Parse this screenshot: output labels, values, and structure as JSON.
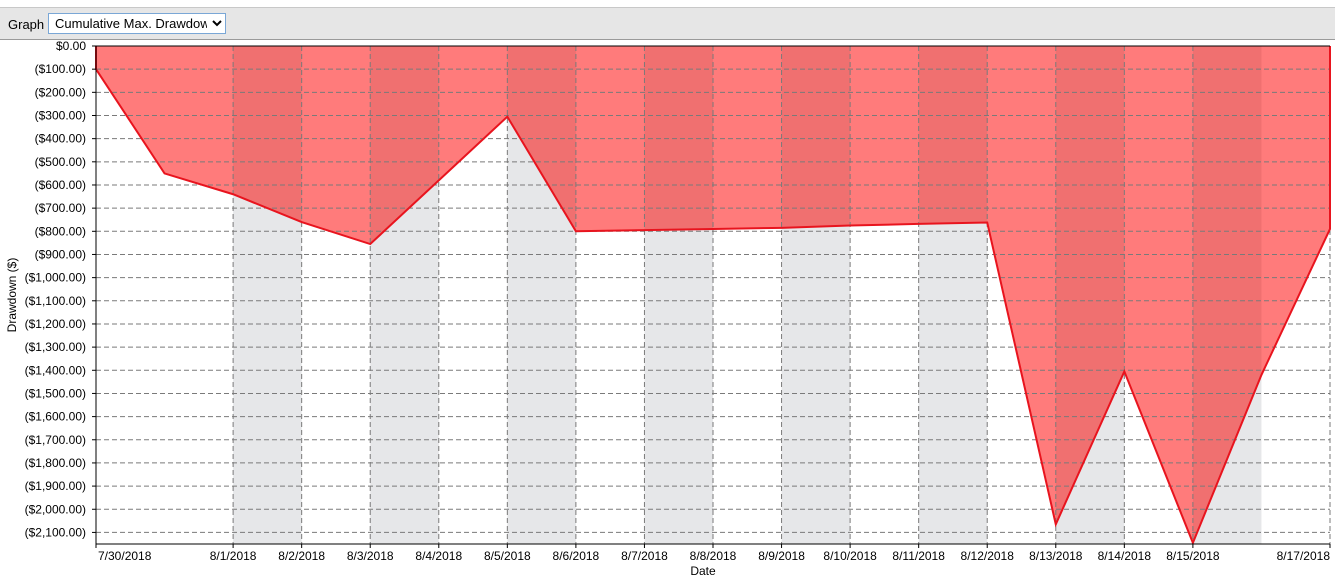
{
  "toolbar": {
    "graph_label": "Graph",
    "graph_select": {
      "selected": "Cumulative Max. Drawdown",
      "options": [
        "Cumulative Max. Drawdown"
      ]
    }
  },
  "chart_data": {
    "type": "area",
    "xlabel": "Date",
    "ylabel": "Drawdown ($)",
    "ylim": [
      -2150,
      0
    ],
    "yticks": [
      0,
      -100,
      -200,
      -300,
      -400,
      -500,
      -600,
      -700,
      -800,
      -900,
      -1000,
      -1100,
      -1200,
      -1300,
      -1400,
      -1500,
      -1600,
      -1700,
      -1800,
      -1900,
      -2000,
      -2100
    ],
    "ytick_labels": [
      "$0.00",
      "($100.00)",
      "($200.00)",
      "($300.00)",
      "($400.00)",
      "($500.00)",
      "($600.00)",
      "($700.00)",
      "($800.00)",
      "($900.00)",
      "($1,000.00)",
      "($1,100.00)",
      "($1,200.00)",
      "($1,300.00)",
      "($1,400.00)",
      "($1,500.00)",
      "($1,600.00)",
      "($1,700.00)",
      "($1,800.00)",
      "($1,900.00)",
      "($2,000.00)",
      "($2,100.00)"
    ],
    "xlim": [
      "2018-07-30",
      "2018-08-17"
    ],
    "xticks": [
      "2018-07-30",
      "2018-08-01",
      "2018-08-02",
      "2018-08-03",
      "2018-08-04",
      "2018-08-05",
      "2018-08-06",
      "2018-08-07",
      "2018-08-08",
      "2018-08-09",
      "2018-08-10",
      "2018-08-11",
      "2018-08-12",
      "2018-08-13",
      "2018-08-14",
      "2018-08-15",
      "2018-08-17"
    ],
    "xtick_labels": [
      "7/30/2018",
      "8/1/2018",
      "8/2/2018",
      "8/3/2018",
      "8/4/2018",
      "8/5/2018",
      "8/6/2018",
      "8/7/2018",
      "8/8/2018",
      "8/9/2018",
      "8/10/2018",
      "8/11/2018",
      "8/12/2018",
      "8/13/2018",
      "8/14/2018",
      "8/15/2018",
      "8/17/2018"
    ],
    "grid": true,
    "colors": {
      "fill_light": "#ff7b7b",
      "fill_dark": "#f07070",
      "line": "#e8141e",
      "band": "#e6e7e9",
      "grid": "#7a7a7a"
    },
    "series": [
      {
        "points": [
          {
            "x": "2018-07-30",
            "y": -100
          },
          {
            "x": "2018-07-31",
            "y": -550
          },
          {
            "x": "2018-08-01",
            "y": -640
          },
          {
            "x": "2018-08-02",
            "y": -760
          },
          {
            "x": "2018-08-03",
            "y": -855
          },
          {
            "x": "2018-08-04",
            "y": -580
          },
          {
            "x": "2018-08-05",
            "y": -305
          },
          {
            "x": "2018-08-06",
            "y": -800
          },
          {
            "x": "2018-08-07",
            "y": -795
          },
          {
            "x": "2018-08-08",
            "y": -790
          },
          {
            "x": "2018-08-09",
            "y": -785
          },
          {
            "x": "2018-08-10",
            "y": -775
          },
          {
            "x": "2018-08-11",
            "y": -768
          },
          {
            "x": "2018-08-12",
            "y": -762
          },
          {
            "x": "2018-08-13",
            "y": -2065
          },
          {
            "x": "2018-08-14",
            "y": -1405
          },
          {
            "x": "2018-08-15",
            "y": -2145
          },
          {
            "x": "2018-08-16",
            "y": -1420
          },
          {
            "x": "2018-08-17",
            "y": -790
          }
        ]
      }
    ]
  }
}
